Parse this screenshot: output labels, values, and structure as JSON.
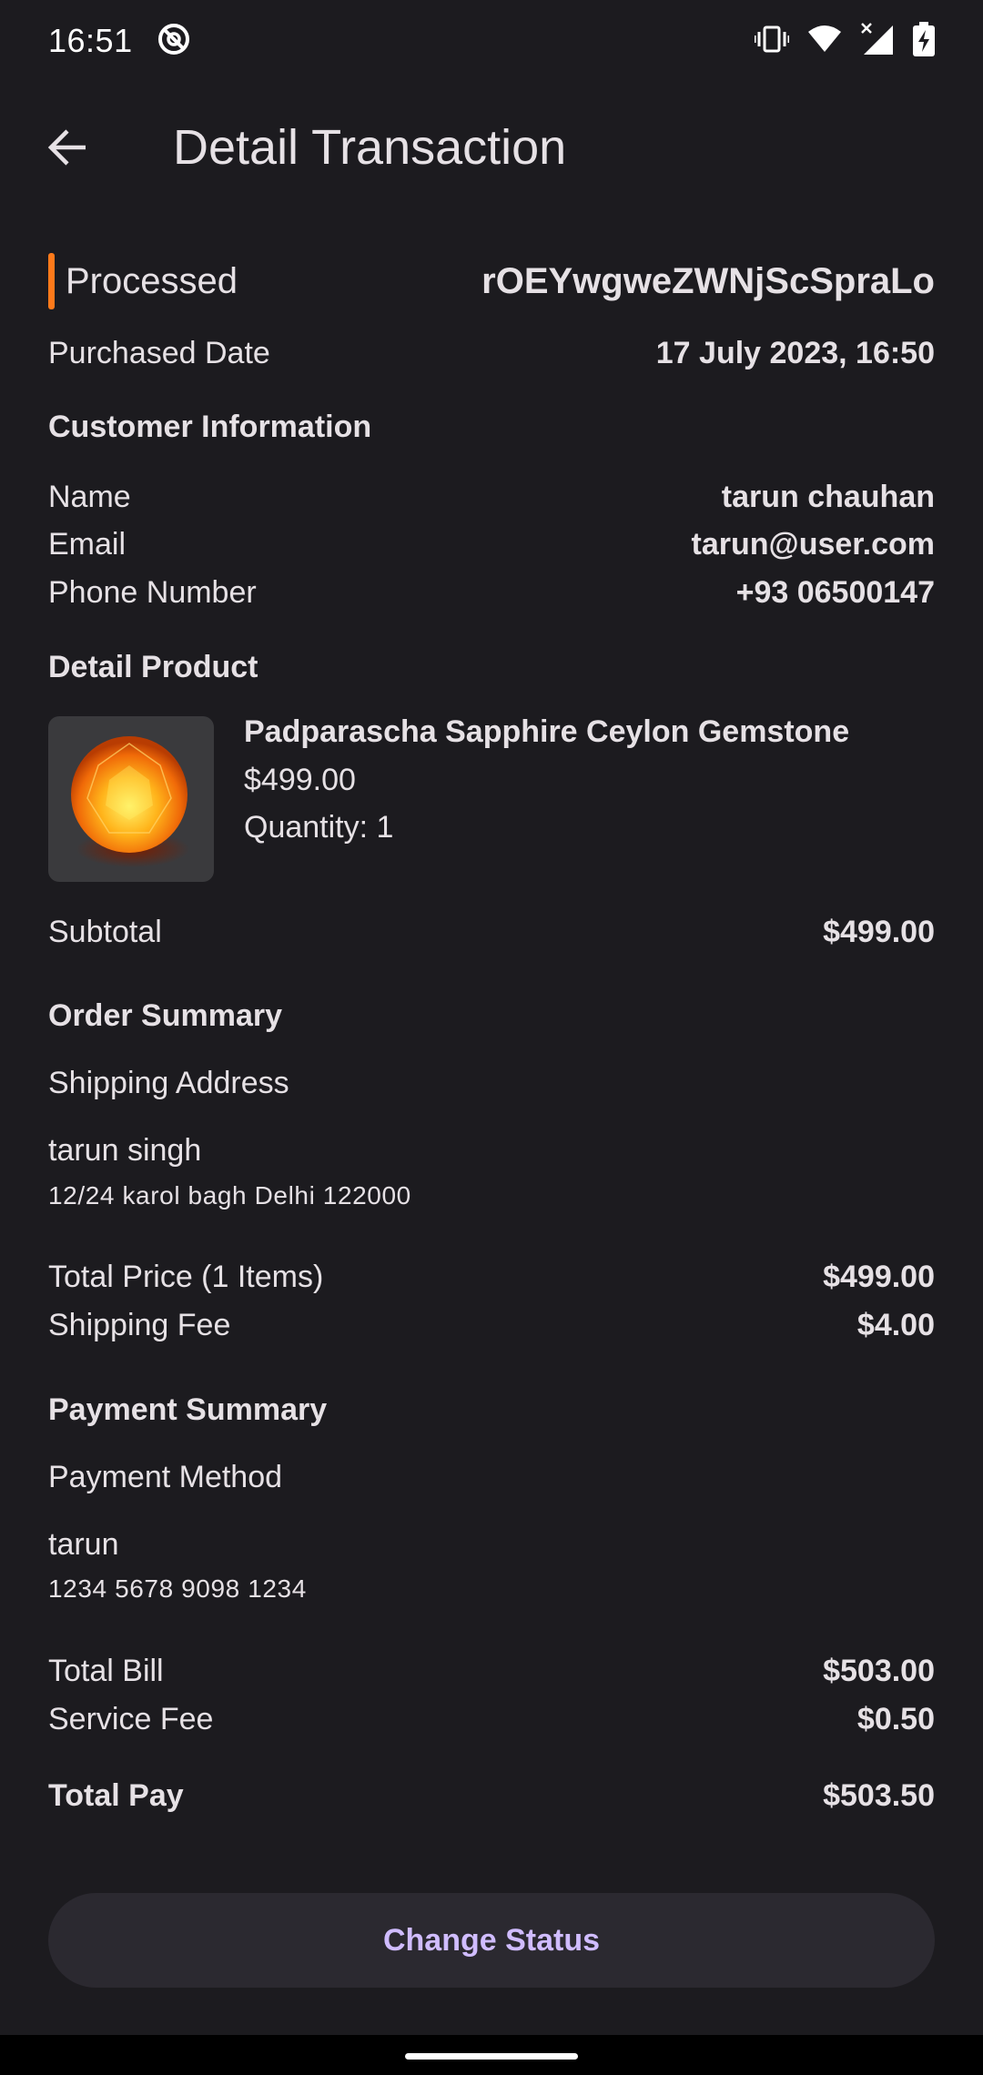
{
  "status_bar": {
    "time": "16:51"
  },
  "app_bar": {
    "title": "Detail Transaction"
  },
  "transaction": {
    "status": "Processed",
    "status_color": "#ff7a1a",
    "id": "rOEYwgweZWNjScSpraLo",
    "purchased_date_label": "Purchased Date",
    "purchased_date": "17 July 2023, 16:50"
  },
  "customer": {
    "section_title": "Customer Information",
    "name_label": "Name",
    "name": "tarun chauhan",
    "email_label": "Email",
    "email": "tarun@user.com",
    "phone_label": "Phone Number",
    "phone": "+93 06500147"
  },
  "product": {
    "section_title": "Detail Product",
    "name": "Padparascha Sapphire Ceylon Gemstone",
    "price": "$499.00",
    "quantity": "Quantity: 1",
    "subtotal_label": "Subtotal",
    "subtotal": "$499.00"
  },
  "order_summary": {
    "section_title": "Order Summary",
    "shipping_address_label": "Shipping Address",
    "recipient": "tarun singh",
    "address": "12/24 karol bagh Delhi 122000",
    "total_price_label": "Total Price (1 Items)",
    "total_price": "$499.00",
    "shipping_fee_label": "Shipping Fee",
    "shipping_fee": "$4.00"
  },
  "payment_summary": {
    "section_title": "Payment Summary",
    "method_label": "Payment Method",
    "card_holder": "tarun",
    "card_number": "1234 5678 9098 1234",
    "total_bill_label": "Total Bill",
    "total_bill": "$503.00",
    "service_fee_label": "Service Fee",
    "service_fee": "$0.50",
    "total_pay_label": "Total Pay",
    "total_pay": "$503.50"
  },
  "actions": {
    "change_status_label": "Change Status",
    "accent_color": "#d0bcff"
  }
}
